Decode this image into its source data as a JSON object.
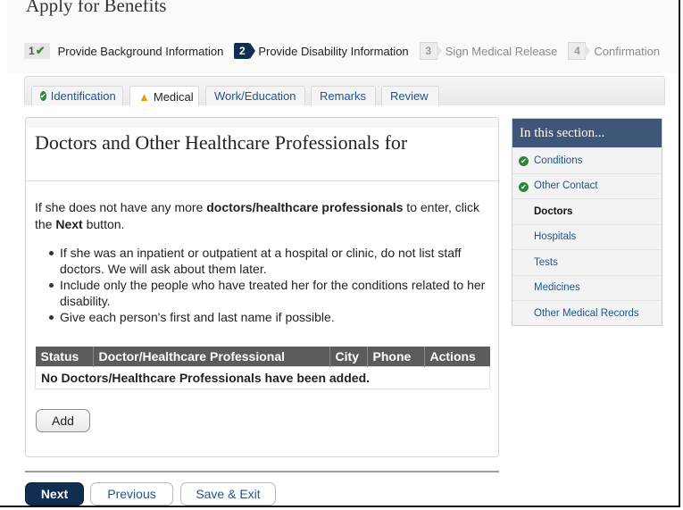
{
  "page": {
    "title": "Apply for Benefits"
  },
  "steps": [
    {
      "number": "1",
      "label": "Provide Background Information",
      "state": "done",
      "check_icon": "checkmark-icon"
    },
    {
      "number": "2",
      "label": "Provide Disability Information",
      "state": "active"
    },
    {
      "number": "3",
      "label": "Sign Medical Release",
      "state": "todo"
    },
    {
      "number": "4",
      "label": "Confirmation",
      "state": "todo"
    }
  ],
  "tabs": [
    {
      "label": "Identification",
      "icon": "check-circle-icon"
    },
    {
      "label": "Medical",
      "icon": "warning-icon",
      "active": true
    },
    {
      "label": "Work/Education"
    },
    {
      "label": "Remarks"
    },
    {
      "label": "Review"
    }
  ],
  "main": {
    "title": "Doctors and Other Healthcare Professionals for",
    "intro_pre": "If she does not have any more ",
    "intro_bold": "doctors/healthcare professionals",
    "intro_mid": " to enter, click the ",
    "intro_next": "Next",
    "intro_post": " button.",
    "bullets": [
      "If she was an inpatient or outpatient at a hospital or clinic, do not list staff doctors. We will ask about them later.",
      "Include only the people who have treated her for the conditions related to her disability.",
      "Give each person's first and last name if possible."
    ],
    "table": {
      "headers": [
        "Status",
        "Doctor/Healthcare Professional",
        "City",
        "Phone",
        "Actions"
      ],
      "empty_message": "No Doctors/Healthcare Professionals have been added."
    },
    "add_label": "Add"
  },
  "footer": {
    "next_label": "Next",
    "previous_label": "Previous",
    "save_exit_label": "Save & Exit"
  },
  "sidebar": {
    "heading": "In this section...",
    "items": [
      {
        "label": "Conditions",
        "state": "done"
      },
      {
        "label": "Other Contact",
        "state": "done"
      },
      {
        "label": "Doctors",
        "state": "current"
      },
      {
        "label": "Hospitals",
        "state": "link"
      },
      {
        "label": "Tests",
        "state": "link"
      },
      {
        "label": "Medicines",
        "state": "link"
      },
      {
        "label": "Other Medical Records",
        "state": "link"
      }
    ]
  },
  "colors": {
    "primary_navy": "#112e51",
    "link_blue": "#205493",
    "success_green": "#2e8540",
    "warning_amber": "#e1a100",
    "sidebar_header": "#3e5677",
    "table_header": "#5b5b5b"
  }
}
